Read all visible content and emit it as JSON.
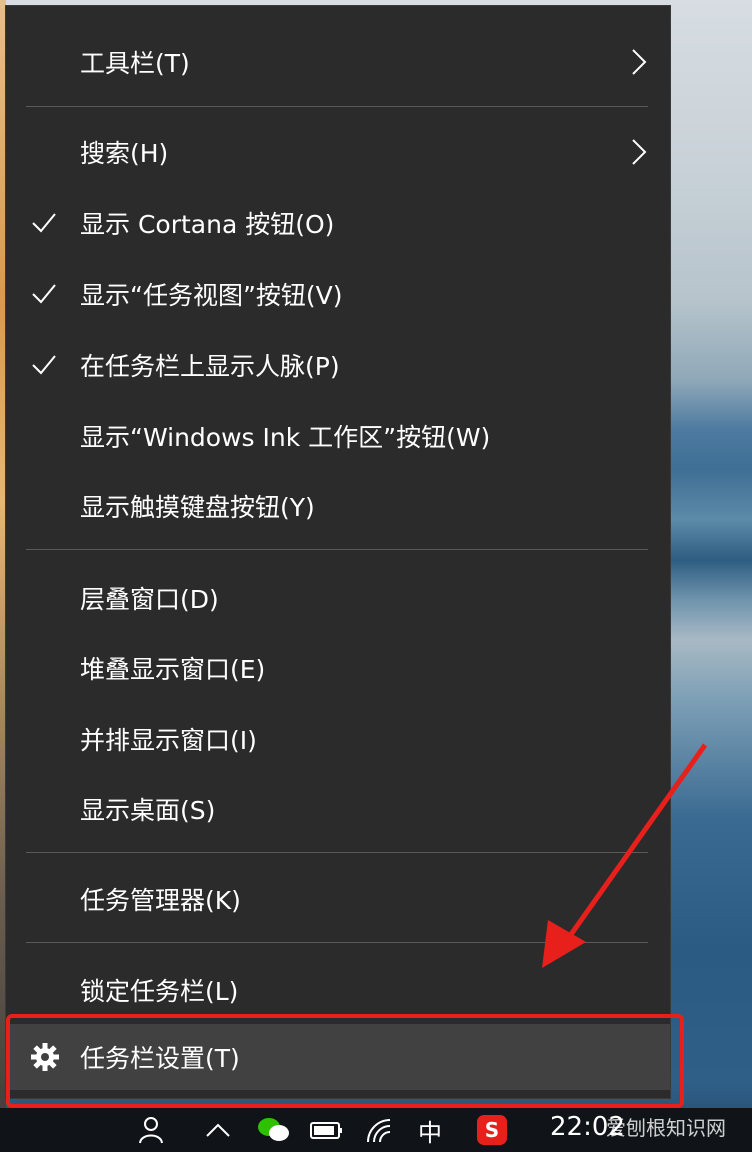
{
  "menu": {
    "items": [
      {
        "label": "工具栏(T)",
        "checked": false,
        "submenu": true
      },
      {
        "label": "搜索(H)",
        "checked": false,
        "submenu": true
      },
      {
        "label": "显示 Cortana 按钮(O)",
        "checked": true,
        "submenu": false
      },
      {
        "label": "显示“任务视图”按钮(V)",
        "checked": true,
        "submenu": false
      },
      {
        "label": "在任务栏上显示人脉(P)",
        "checked": true,
        "submenu": false
      },
      {
        "label": "显示“Windows Ink 工作区”按钮(W)",
        "checked": false,
        "submenu": false
      },
      {
        "label": "显示触摸键盘按钮(Y)",
        "checked": false,
        "submenu": false
      },
      {
        "label": "层叠窗口(D)",
        "checked": false,
        "submenu": false
      },
      {
        "label": "堆叠显示窗口(E)",
        "checked": false,
        "submenu": false
      },
      {
        "label": "并排显示窗口(I)",
        "checked": false,
        "submenu": false
      },
      {
        "label": "显示桌面(S)",
        "checked": false,
        "submenu": false
      },
      {
        "label": "任务管理器(K)",
        "checked": false,
        "submenu": false
      },
      {
        "label": "锁定任务栏(L)",
        "checked": false,
        "submenu": false
      },
      {
        "label": "任务栏设置(T)",
        "checked": false,
        "submenu": false,
        "icon": "gear-icon",
        "highlighted": true
      }
    ]
  },
  "taskbar": {
    "ime": "中",
    "clock": "22:02",
    "icons": [
      "people-icon",
      "chevron-up-icon",
      "wechat-icon",
      "battery-icon",
      "wifi-icon",
      "ime-icon",
      "sogou-icon"
    ]
  },
  "watermark": "爱刨根知识网",
  "colors": {
    "menu_bg": "#2b2b2b",
    "hover_bg": "#414141",
    "highlight": "#e8201c",
    "separator": "#5a5a5a"
  }
}
